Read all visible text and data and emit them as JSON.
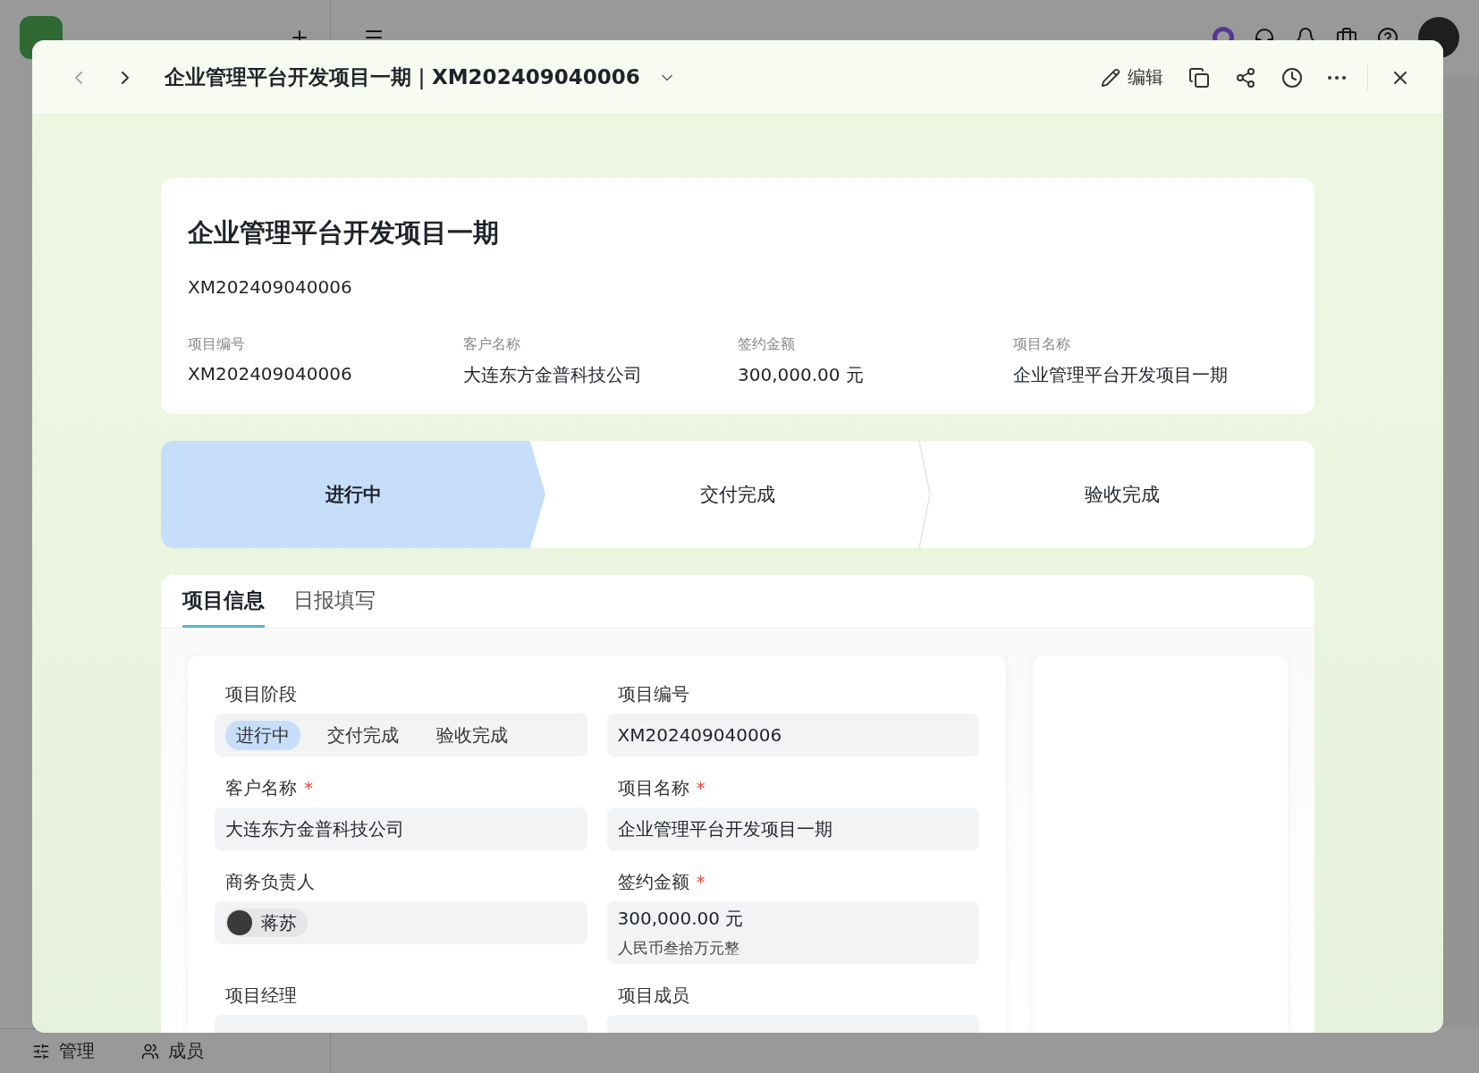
{
  "app": {
    "bottom_nav": [
      {
        "kind": "settings",
        "label": "管理"
      },
      {
        "kind": "users",
        "label": "成员"
      }
    ]
  },
  "modal": {
    "title": "企业管理平台开发项目一期｜XM202409040006",
    "edit_label": "编辑"
  },
  "summary": {
    "title": "企业管理平台开发项目一期",
    "code": "XM202409040006",
    "fields": [
      {
        "label": "项目编号",
        "value": "XM202409040006"
      },
      {
        "label": "客户名称",
        "value": "大连东方金普科技公司"
      },
      {
        "label": "签约金额",
        "value": "300,000.00 元"
      },
      {
        "label": "项目名称",
        "value": "企业管理平台开发项目一期"
      }
    ]
  },
  "stages": [
    {
      "label": "进行中",
      "selected": true
    },
    {
      "label": "交付完成",
      "selected": false
    },
    {
      "label": "验收完成",
      "selected": false
    }
  ],
  "tabs": [
    {
      "label": "项目信息",
      "selected": true
    },
    {
      "label": "日报填写",
      "selected": false
    }
  ],
  "form": {
    "required_mark": "*",
    "fields": [
      {
        "kind": "segment",
        "label": "项目阶段",
        "required": false,
        "options": [
          {
            "label": "进行中",
            "selected": true
          },
          {
            "label": "交付完成",
            "selected": false
          },
          {
            "label": "验收完成",
            "selected": false
          }
        ]
      },
      {
        "kind": "text",
        "label": "项目编号",
        "required": false,
        "value": "XM202409040006"
      },
      {
        "kind": "text",
        "label": "客户名称",
        "required": true,
        "value": "大连东方金普科技公司"
      },
      {
        "kind": "text",
        "label": "项目名称",
        "required": true,
        "value": "企业管理平台开发项目一期"
      },
      {
        "kind": "person",
        "label": "商务负责人",
        "required": false,
        "value": "蒋苏"
      },
      {
        "kind": "amount",
        "label": "签约金额",
        "required": true,
        "value": "300,000.00 元",
        "note": "人民币叁拾万元整"
      },
      {
        "kind": "text",
        "label": "项目经理",
        "required": false
      },
      {
        "kind": "text",
        "label": "项目成员",
        "required": false
      }
    ]
  }
}
